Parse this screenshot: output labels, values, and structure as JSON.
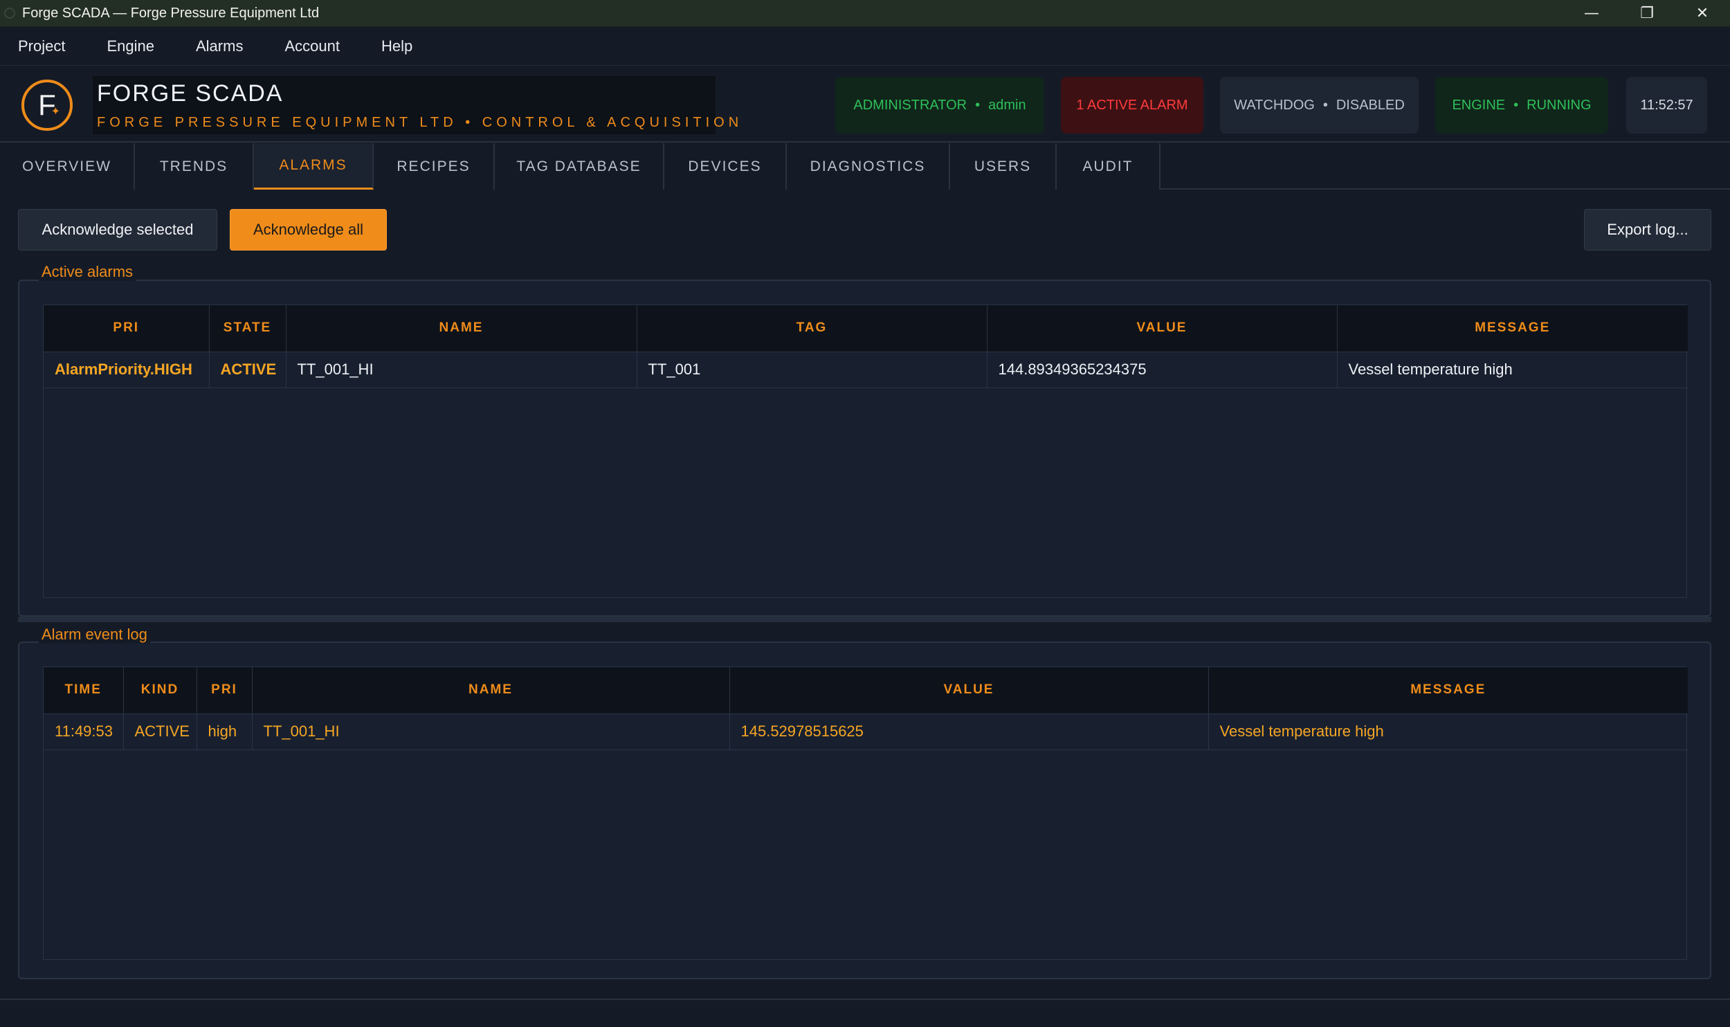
{
  "window": {
    "title": "Forge SCADA — Forge Pressure Equipment Ltd"
  },
  "menu": [
    "Project",
    "Engine",
    "Alarms",
    "Account",
    "Help"
  ],
  "header": {
    "brand_name": "FORGE SCADA",
    "brand_sub": "FORGE PRESSURE EQUIPMENT LTD  •  CONTROL & ACQUISITION",
    "logo_letter": "F",
    "role": "ADMINISTRATOR",
    "user": "admin",
    "alarm_status": "1 ACTIVE ALARM",
    "watchdog_label": "WATCHDOG",
    "watchdog_state": "DISABLED",
    "engine_label": "ENGINE",
    "engine_state": "RUNNING",
    "clock": "11:52:57"
  },
  "tabs": [
    "OVERVIEW",
    "TRENDS",
    "ALARMS",
    "RECIPES",
    "TAG DATABASE",
    "DEVICES",
    "DIAGNOSTICS",
    "USERS",
    "AUDIT"
  ],
  "active_tab": "ALARMS",
  "toolbar": {
    "ack_selected": "Acknowledge selected",
    "ack_all": "Acknowledge all",
    "export": "Export log..."
  },
  "active_alarms": {
    "title": "Active alarms",
    "columns": [
      "PRI",
      "STATE",
      "NAME",
      "TAG",
      "VALUE",
      "MESSAGE"
    ],
    "rows": [
      {
        "pri": "AlarmPriority.HIGH",
        "state": "ACTIVE",
        "name": "TT_001_HI",
        "tag": "TT_001",
        "value": "144.89349365234375",
        "message": "Vessel temperature high"
      }
    ]
  },
  "event_log": {
    "title": "Alarm event log",
    "columns": [
      "TIME",
      "KIND",
      "PRI",
      "NAME",
      "VALUE",
      "MESSAGE"
    ],
    "rows": [
      {
        "time": "11:49:53",
        "kind": "ACTIVE",
        "pri": "high",
        "name": "TT_001_HI",
        "value": "145.52978515625",
        "message": "Vessel temperature high"
      }
    ]
  },
  "colors": {
    "accent": "#ef8c1a",
    "ok": "#2fbf5a",
    "alarm": "#ff3b3b",
    "background": "#151b26"
  }
}
